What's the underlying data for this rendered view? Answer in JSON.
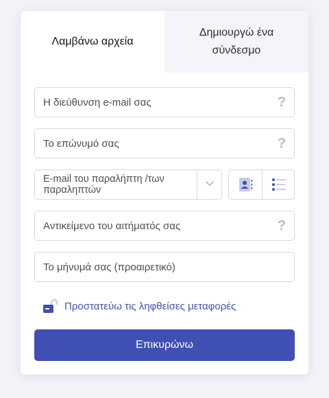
{
  "tabs": {
    "receive": "Λαμβάνω αρχεία",
    "create_link": "Δημιουργώ ένα σύνδεσμο"
  },
  "form": {
    "email_placeholder": "Η διεύθυνση e-mail σας",
    "surname_placeholder": "Το επώνυμό σας",
    "recipients_placeholder": "E-mail του παραλήπτη /των παραληπτών",
    "subject_placeholder": "Αντικείμενο του αιτήματός σας",
    "message_placeholder": "Το μήνυμά σας (προαιρετικό)",
    "help_glyph": "?"
  },
  "protect": {
    "label": "Προστατεύω τις ληφθείσες μεταφορές"
  },
  "submit": {
    "label": "Επικυρώνω"
  },
  "colors": {
    "accent": "#3f4fb3",
    "link": "#3f51b5",
    "tab_inactive_bg": "#f3f5fa",
    "border": "#d5d8e0"
  },
  "icons": {
    "help": "question-mark-icon",
    "chevron": "chevron-down-icon",
    "contacts": "contact-book-icon",
    "list": "list-icon",
    "lock": "unlocked-padlock-icon"
  }
}
